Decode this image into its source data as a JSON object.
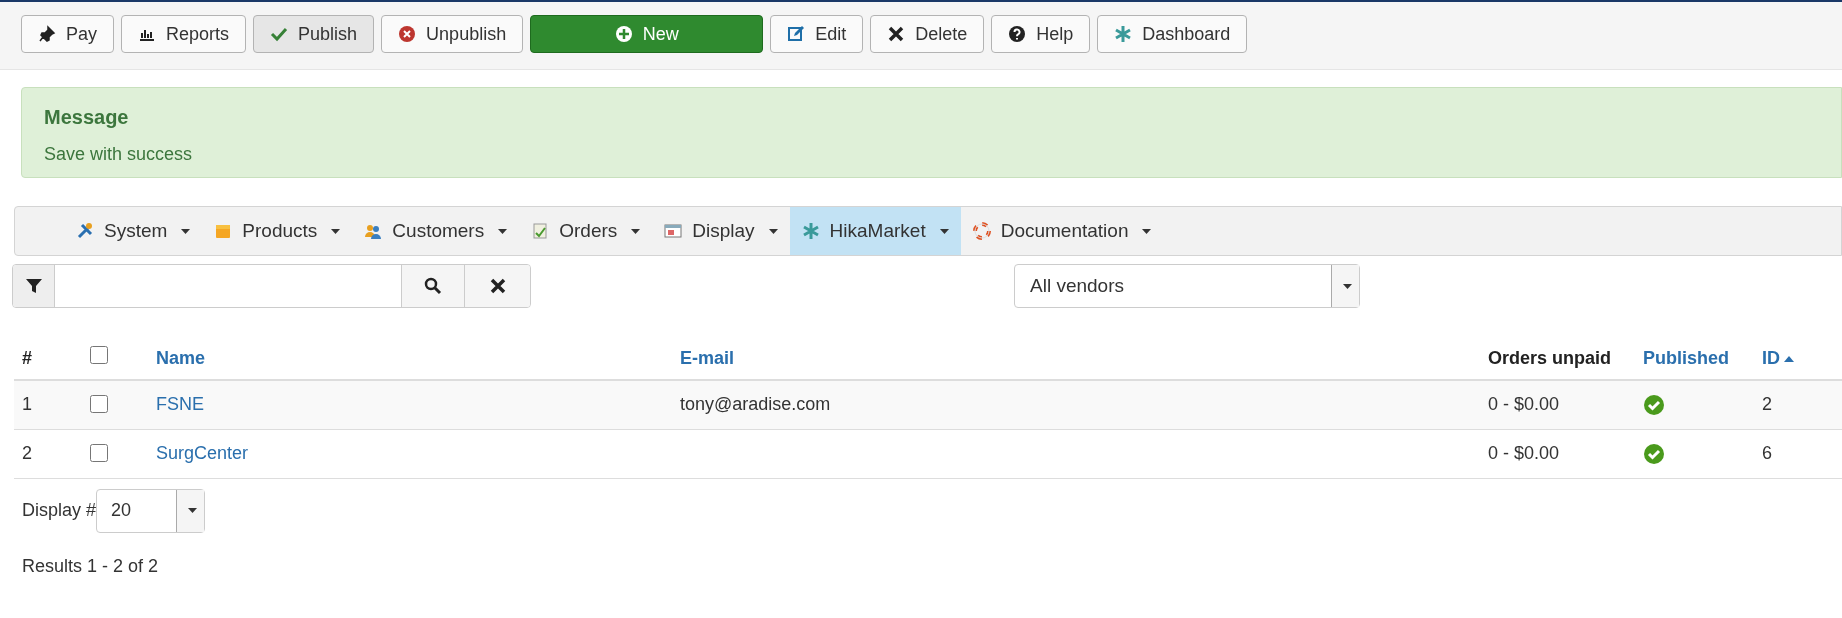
{
  "toolbar": [
    {
      "label": "Pay",
      "kind": "default"
    },
    {
      "label": "Reports",
      "kind": "default"
    },
    {
      "label": "Publish",
      "kind": "pressed"
    },
    {
      "label": "Unpublish",
      "kind": "default"
    },
    {
      "label": "New",
      "kind": "primary"
    },
    {
      "label": "Edit",
      "kind": "default"
    },
    {
      "label": "Delete",
      "kind": "default"
    },
    {
      "label": "Help",
      "kind": "default"
    },
    {
      "label": "Dashboard",
      "kind": "default"
    }
  ],
  "message": {
    "title": "Message",
    "text": "Save with success"
  },
  "menu": [
    {
      "label": "System",
      "selected": false
    },
    {
      "label": "Products",
      "selected": false
    },
    {
      "label": "Customers",
      "selected": false
    },
    {
      "label": "Orders",
      "selected": false
    },
    {
      "label": "Display",
      "selected": false
    },
    {
      "label": "HikaMarket",
      "selected": true
    },
    {
      "label": "Documentation",
      "selected": false
    }
  ],
  "vendor_select": {
    "value": "All vendors"
  },
  "table": {
    "select_all_checked": false,
    "columns": [
      {
        "label": "#",
        "kind": "plain"
      },
      {
        "kind": "checkbox"
      },
      {
        "label": "Name",
        "kind": "link"
      },
      {
        "label": "E-mail",
        "kind": "link"
      },
      {
        "label": "Orders unpaid",
        "kind": "plain"
      },
      {
        "label": "Published",
        "kind": "link"
      },
      {
        "label": "ID",
        "kind": "sorted"
      }
    ],
    "rows": [
      {
        "num": "1",
        "checked": false,
        "name": "FSNE",
        "email": "tony@aradise.com",
        "orders_unpaid": "0 - $0.00",
        "published": true,
        "id": "2"
      },
      {
        "num": "2",
        "checked": false,
        "name": "SurgCenter",
        "email": "",
        "orders_unpaid": "0 - $0.00",
        "published": true,
        "id": "6"
      }
    ]
  },
  "pagination": {
    "label": "Display #",
    "value": "20",
    "results": "Results 1 - 2 of 2"
  }
}
